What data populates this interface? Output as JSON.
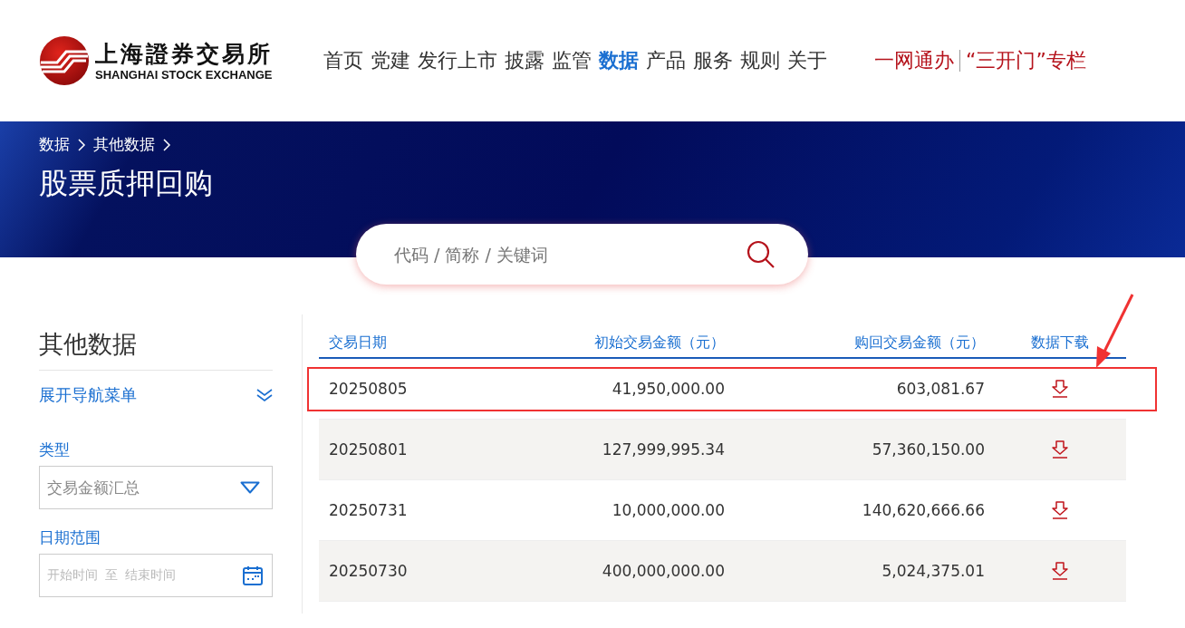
{
  "logo": {
    "name_cn": "上海證券交易所",
    "name_en": "SHANGHAI STOCK EXCHANGE"
  },
  "nav": [
    {
      "label": "首页",
      "selected": false
    },
    {
      "label": "党建",
      "selected": false
    },
    {
      "label": "发行上市",
      "selected": false
    },
    {
      "label": "披露",
      "selected": false
    },
    {
      "label": "监管",
      "selected": false
    },
    {
      "label": "数据",
      "selected": true
    },
    {
      "label": "产品",
      "selected": false
    },
    {
      "label": "服务",
      "selected": false
    },
    {
      "label": "规则",
      "selected": false
    },
    {
      "label": "关于",
      "selected": false
    }
  ],
  "quick_links": [
    "一网通办",
    "“三开门”专栏"
  ],
  "breadcrumb": [
    "数据",
    "其他数据"
  ],
  "page_title": "股票质押回购",
  "search": {
    "placeholder": "代码 / 简称 / 关键词"
  },
  "sidebar": {
    "title": "其他数据",
    "expand_menu": "展开导航菜单",
    "type_label": "类型",
    "type_value": "交易金额汇总",
    "date_label": "日期范围",
    "date_start_placeholder": "开始时间",
    "date_separator": "至",
    "date_end_placeholder": "结束时间"
  },
  "table": {
    "columns": [
      "交易日期",
      "初始交易金额（元）",
      "购回交易金额（元）",
      "数据下载"
    ],
    "rows": [
      {
        "date": "20250805",
        "initial": "41,950,000.00",
        "repurchase": "603,081.67",
        "highlighted": true
      },
      {
        "date": "20250801",
        "initial": "127,999,995.34",
        "repurchase": "57,360,150.00",
        "highlighted": false
      },
      {
        "date": "20250731",
        "initial": "10,000,000.00",
        "repurchase": "140,620,666.66",
        "highlighted": false
      },
      {
        "date": "20250730",
        "initial": "400,000,000.00",
        "repurchase": "5,024,375.01",
        "highlighted": false
      }
    ]
  }
}
